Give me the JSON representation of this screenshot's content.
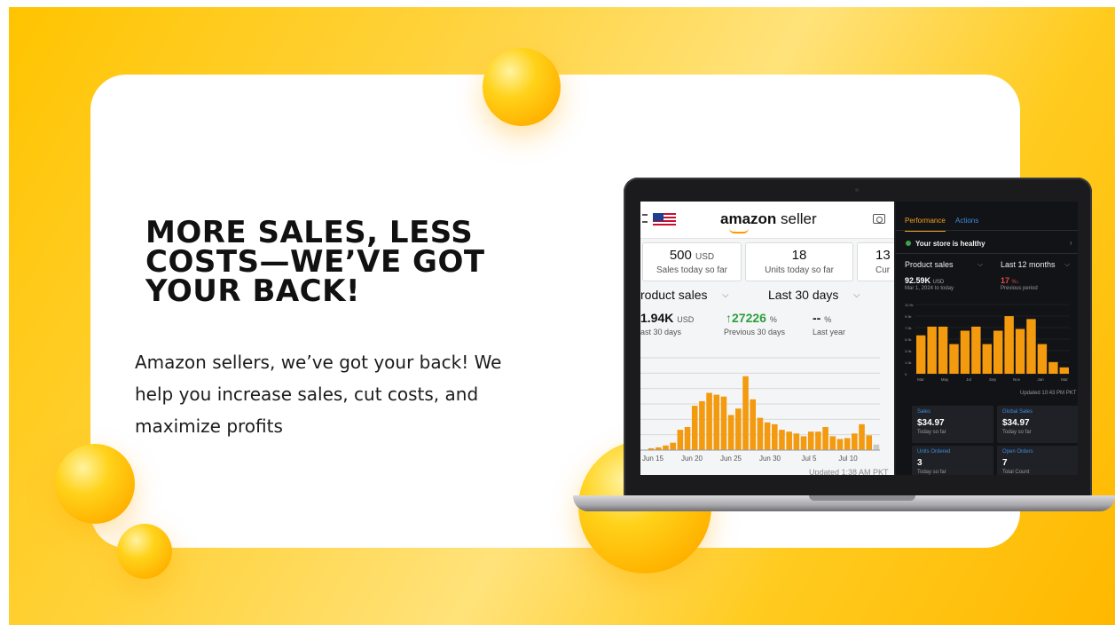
{
  "banner": {
    "headline": "MORE SALES, LESS COSTS—WE’VE GOT YOUR BACK!",
    "body": "Amazon sellers, we’ve got your back! We help you increase sales, cut costs, and maximize profits"
  },
  "colors": {
    "accent": "#ffc400",
    "bar_orange": "#f39a0e",
    "dark_bg": "#121316",
    "green": "#2e9e3e",
    "red": "#e04b4b"
  },
  "app_light": {
    "logo_bold": "amazon",
    "logo_rest": " seller",
    "tiles": [
      {
        "value": "500",
        "unit": "USD",
        "label": "Sales today so far"
      },
      {
        "value": "18",
        "unit": "",
        "label": "Units today so far"
      },
      {
        "value": "13",
        "unit": "",
        "label": "Cur"
      }
    ],
    "dropdown_metric": "roduct sales",
    "dropdown_period": "Last 30 days",
    "metrics": [
      {
        "value": "1.94K",
        "unit": "USD",
        "label": "ast 30 days"
      },
      {
        "value": "↑27226",
        "unit": "%",
        "label": "Previous 30 days"
      },
      {
        "value": "--",
        "unit": "%",
        "label": "Last year"
      }
    ],
    "updated": "Updated 1:38 AM PKT",
    "chart_data": {
      "type": "bar",
      "x_ticks": [
        "Jun 15",
        "Jun 20",
        "Jun 25",
        "Jun 30",
        "Jul 5",
        "Jul 10"
      ],
      "values": [
        0.02,
        0.03,
        0.05,
        0.08,
        0.22,
        0.25,
        0.48,
        0.53,
        0.62,
        0.6,
        0.58,
        0.38,
        0.45,
        0.8,
        0.55,
        0.35,
        0.3,
        0.28,
        0.22,
        0.2,
        0.18,
        0.15,
        0.2,
        0.2,
        0.25,
        0.15,
        0.12,
        0.13,
        0.18,
        0.28,
        0.16,
        0.06
      ],
      "ylim": [
        0,
        1
      ]
    }
  },
  "app_dark": {
    "tabs": [
      "Performance",
      "Actions"
    ],
    "health": "Your store is healthy",
    "dropdown_metric": "Product sales",
    "dropdown_period": "Last 12 months",
    "current_value": "92.59K",
    "current_unit": "USD",
    "current_label": "Mar 1, 2024 to today",
    "prev_value": "17",
    "prev_arrow": "%↓",
    "prev_label": "Previous period",
    "updated": "Updated 10:43 PM PKT",
    "chart_data": {
      "type": "bar",
      "y_ticks": [
        "11.9k",
        "9.9k",
        "7.9k",
        "5.9k",
        "3.9k",
        "1.9k",
        "0"
      ],
      "x_ticks": [
        "Mar",
        "May",
        "Jul",
        "Sep",
        "Nov",
        "Jan",
        "Mar"
      ],
      "values": [
        6.6,
        8.1,
        8.1,
        5.1,
        7.4,
        8.1,
        5.1,
        7.4,
        9.9,
        7.7,
        9.4,
        5.1,
        2.0,
        1.1
      ],
      "ylim": [
        0,
        11.9
      ]
    },
    "cards": [
      {
        "label": "Sales",
        "value": "$34.97",
        "sub": "Today so far"
      },
      {
        "label": "Global Sales",
        "value": "$34.97",
        "sub": "Today so far"
      },
      {
        "label": "Units Ordered",
        "value": "3",
        "sub": "Today so far"
      },
      {
        "label": "Open Orders",
        "value": "7",
        "sub": "Total Count"
      }
    ]
  }
}
